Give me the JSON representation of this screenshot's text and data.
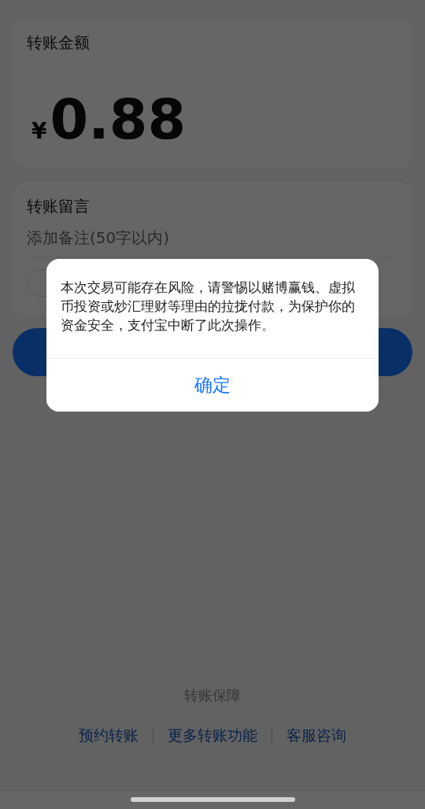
{
  "amount_card": {
    "label": "转账金额",
    "currency": "¥",
    "amount": "0.88"
  },
  "message_card": {
    "label": "转账留言",
    "placeholder": "添加备注(50字以内)"
  },
  "dialog": {
    "message": "本次交易可能存在风险，请警惕以赌博赢钱、虚拟币投资或炒汇理财等理由的拉拢付款，为保护你的资金安全，支付宝中断了此次操作。",
    "confirm_button": "确定"
  },
  "footer": {
    "title": "转账保障",
    "links": [
      "预约转账",
      "更多转账功能",
      "客服咨询"
    ]
  }
}
